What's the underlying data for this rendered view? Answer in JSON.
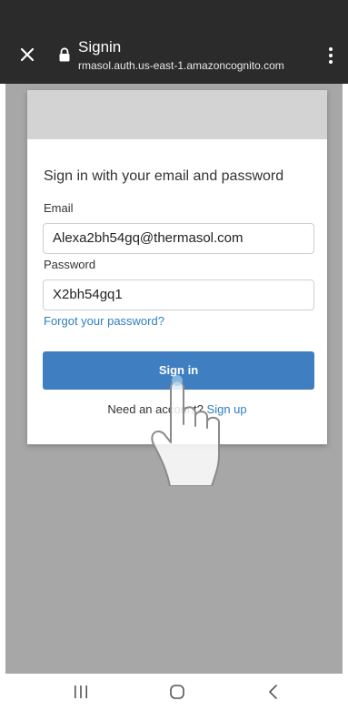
{
  "browser": {
    "title": "Signin",
    "url": "rmasol.auth.us-east-1.amazoncognito.com"
  },
  "form": {
    "heading": "Sign in with your email and password",
    "email_label": "Email",
    "email_value": "Alexa2bh54gq@thermasol.com",
    "password_label": "Password",
    "password_value": "X2bh54gq1",
    "forgot_link": "Forgot your password?",
    "signin_button": "Sign in",
    "signup_prompt": "Need an account?",
    "signup_link": "Sign up"
  },
  "colors": {
    "browser_bar": "#2b2b2b",
    "backdrop": "#a7a7a7",
    "primary_button": "#3f7fc1",
    "link": "#2f7fbf"
  }
}
